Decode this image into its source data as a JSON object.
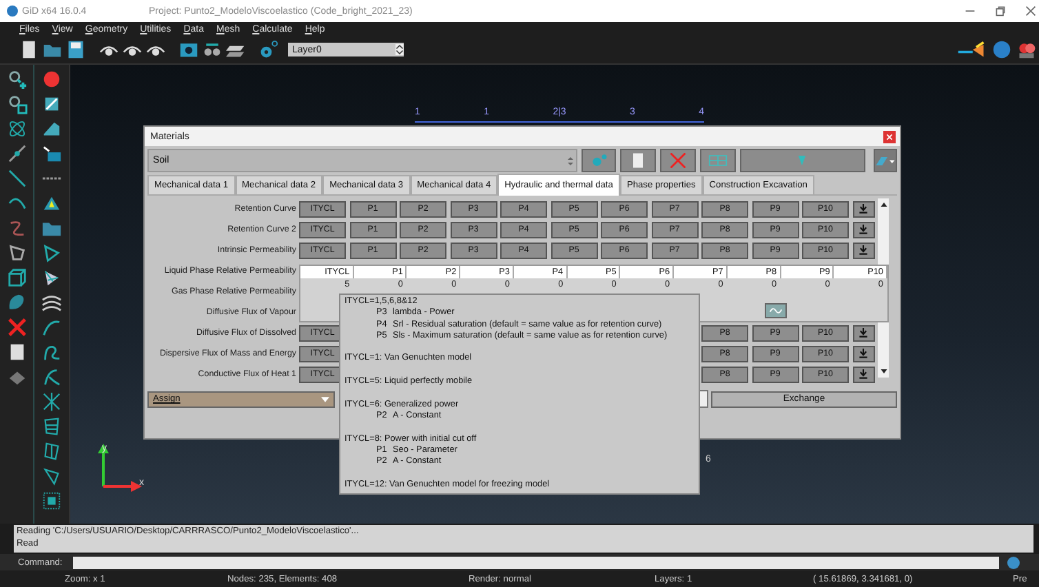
{
  "window": {
    "app": "GiD x64 16.0.4",
    "title": "Project: Punto2_ModeloViscoelastico (Code_bright_2021_23)"
  },
  "menu": [
    "Files",
    "View",
    "Geometry",
    "Utilities",
    "Data",
    "Mesh",
    "Calculate",
    "Help"
  ],
  "toolbar": {
    "layer": "Layer0"
  },
  "canvas": {
    "ruler": [
      "1",
      "1",
      "2|3",
      "3",
      "4"
    ],
    "label": "6",
    "axes": {
      "x": "x",
      "y": "y"
    }
  },
  "materials": {
    "title": "Materials",
    "material": "Soil",
    "tabs": [
      {
        "label": "Mechanical data 1",
        "selected": false
      },
      {
        "label": "Mechanical data 2",
        "selected": false
      },
      {
        "label": "Mechanical data 3",
        "selected": false
      },
      {
        "label": "Mechanical data 4",
        "selected": false
      },
      {
        "label": "Hydraulic and thermal data",
        "selected": true
      },
      {
        "label": "Phase properties",
        "selected": false
      },
      {
        "label": "Construction Excavation",
        "selected": false
      }
    ],
    "rows": [
      {
        "label": "Retention Curve",
        "kind": "buttons",
        "buttons": [
          "ITYCL",
          "P1",
          "P2",
          "P3",
          "P4",
          "P5",
          "P6",
          "P7",
          "P8",
          "P9",
          "P10"
        ]
      },
      {
        "label": "Retention Curve 2",
        "kind": "buttons",
        "buttons": [
          "ITYCL",
          "P1",
          "P2",
          "P3",
          "P4",
          "P5",
          "P6",
          "P7",
          "P8",
          "P9",
          "P10"
        ]
      },
      {
        "label": "Intrinsic Permeability",
        "kind": "buttons",
        "buttons": [
          "ITYCL",
          "P1",
          "P2",
          "P3",
          "P4",
          "P5",
          "P6",
          "P7",
          "P8",
          "P9",
          "P10"
        ]
      },
      {
        "label": "Liquid Phase Relative Permeability",
        "kind": "table",
        "columns": [
          "ITYCL",
          "P1",
          "P2",
          "P3",
          "P4",
          "P5",
          "P6",
          "P7",
          "P8",
          "P9",
          "P10"
        ],
        "values": [
          "5",
          "0",
          "0",
          "0",
          "0",
          "0",
          "0",
          "0",
          "0",
          "0",
          "0"
        ]
      },
      {
        "label": "Gas Phase Relative Permeability",
        "kind": "label"
      },
      {
        "label": "Diffusive Flux of Vapour",
        "kind": "label"
      },
      {
        "label": "Diffusive Flux of Dissolved",
        "kind": "buttons",
        "buttons": [
          "ITYCL",
          "P8",
          "P9",
          "P10"
        ]
      },
      {
        "label": "Dispersive Flux of Mass and Energy",
        "kind": "buttons",
        "buttons": [
          "ITYCL",
          "P8",
          "P9",
          "P10"
        ]
      },
      {
        "label": "Conductive Flux of Heat 1",
        "kind": "buttons",
        "buttons": [
          "ITYCL",
          "P8",
          "P9",
          "P10"
        ]
      }
    ],
    "assign": "Assign",
    "exchange": "Exchange"
  },
  "tooltip": [
    {
      "heading": "ITYCL=1,5,6,8&12",
      "params": [
        {
          "name": "P3",
          "desc": "lambda - Power"
        },
        {
          "name": "P4",
          "desc": "Srl - Residual saturation (default = same value as for retention curve)"
        },
        {
          "name": "P5",
          "desc": "Sls - Maximum saturation (default = same value as for retention curve)"
        }
      ]
    },
    {
      "heading": "ITYCL=1: Van Genuchten model"
    },
    {
      "heading": "ITYCL=5: Liquid perfectly mobile"
    },
    {
      "heading": "ITYCL=6: Generalized power",
      "params": [
        {
          "name": "P2",
          "desc": "A - Constant"
        }
      ]
    },
    {
      "heading": "ITYCL=8: Power with initial cut off",
      "params": [
        {
          "name": "P1",
          "desc": "Seo - Parameter"
        },
        {
          "name": "P2",
          "desc": "A - Constant"
        }
      ]
    },
    {
      "heading": "ITYCL=12: Van Genuchten model for freezing model"
    }
  ],
  "messages": [
    "Reading 'C:/Users/USUARIO/Desktop/CARRRASCO/Punto2_ModeloViscoelastico'...",
    "Read"
  ],
  "command": {
    "label": "Command:"
  },
  "status_bar": [
    "Zoom: x 1",
    "Nodes: 235, Elements: 408",
    "Render: normal",
    "Layers: 1",
    "( 15.61869, 3.341681, 0)",
    "Pre"
  ]
}
